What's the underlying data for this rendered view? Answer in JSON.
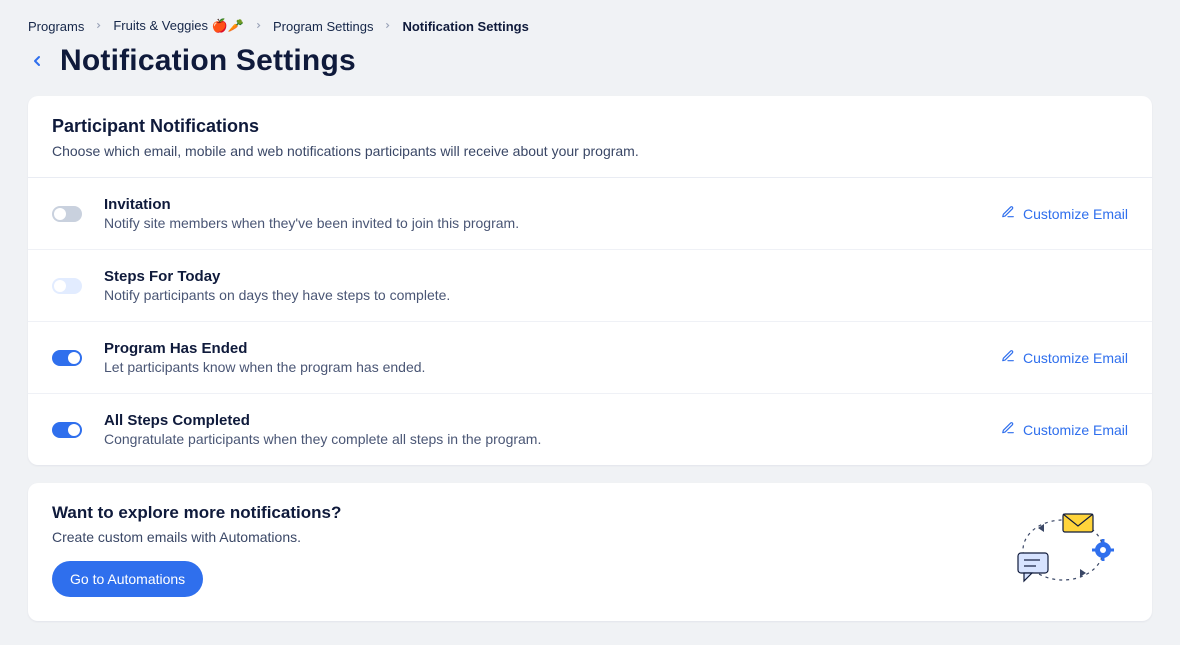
{
  "breadcrumb": {
    "items": [
      "Programs",
      "Fruits & Veggies 🍎🥕",
      "Program Settings"
    ],
    "current": "Notification Settings"
  },
  "title": "Notification Settings",
  "section": {
    "heading": "Participant Notifications",
    "subheading": "Choose which email, mobile and web notifications participants will receive about your program."
  },
  "rows": [
    {
      "title": "Invitation",
      "desc": "Notify site members when they've been invited to join this program.",
      "toggle_state": "off-neutral",
      "has_customize": true,
      "customize_label": "Customize Email"
    },
    {
      "title": "Steps For Today",
      "desc": "Notify participants on days they have steps to complete.",
      "toggle_state": "off-light",
      "has_customize": false
    },
    {
      "title": "Program Has Ended",
      "desc": "Let participants know when the program has ended.",
      "toggle_state": "on",
      "has_customize": true,
      "customize_label": "Customize Email"
    },
    {
      "title": "All Steps Completed",
      "desc": "Congratulate participants when they complete all steps in the program.",
      "toggle_state": "on",
      "has_customize": true,
      "customize_label": "Customize Email"
    }
  ],
  "explore": {
    "heading": "Want to explore more notifications?",
    "subheading": "Create custom emails with Automations.",
    "button": "Go to Automations"
  }
}
